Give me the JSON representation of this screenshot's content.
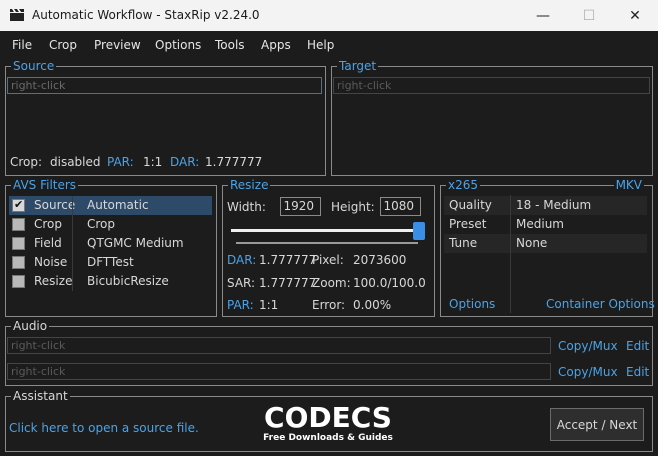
{
  "window": {
    "title": "Automatic Workflow - StaxRip v2.24.0",
    "app_icon": "clapperboard-icon",
    "minimize_glyph": "—",
    "maximize_glyph": "☐",
    "close_glyph": "✕"
  },
  "menu": [
    "File",
    "Crop",
    "Preview",
    "Options",
    "Tools",
    "Apps",
    "Help"
  ],
  "source": {
    "title": "Source",
    "placeholder": "right-click",
    "crop_label": "Crop:",
    "crop_value": "disabled",
    "par_label": "PAR:",
    "par_value": "1:1",
    "dar_label": "DAR:",
    "dar_value": "1.777777"
  },
  "target": {
    "title": "Target",
    "placeholder": "right-click"
  },
  "filters": {
    "title": "AVS Filters",
    "items": [
      {
        "name": "Source",
        "value": "Automatic",
        "checked": true,
        "selected": true
      },
      {
        "name": "Crop",
        "value": "Crop",
        "checked": false,
        "selected": false
      },
      {
        "name": "Field",
        "value": "QTGMC Medium",
        "checked": false,
        "selected": false
      },
      {
        "name": "Noise",
        "value": "DFTTest",
        "checked": false,
        "selected": false
      },
      {
        "name": "Resize",
        "value": "BicubicResize",
        "checked": false,
        "selected": false
      }
    ]
  },
  "resize": {
    "title": "Resize",
    "width_label": "Width:",
    "width_value": "1920",
    "height_label": "Height:",
    "height_value": "1080",
    "dar_label": "DAR:",
    "dar_value": "1.777777",
    "pixel_label": "Pixel:",
    "pixel_value": "2073600",
    "sar_label": "SAR:",
    "sar_value": "1.777777",
    "zoom_label": "Zoom:",
    "zoom_value": "100.0/100.0",
    "par_label": "PAR:",
    "par_value": "1:1",
    "error_label": "Error:",
    "error_value": "0.00%"
  },
  "encoder": {
    "title": "x265",
    "container": "MKV",
    "rows": [
      {
        "key": "Quality",
        "value": "18 - Medium"
      },
      {
        "key": "Preset",
        "value": "Medium"
      },
      {
        "key": "Tune",
        "value": "None"
      }
    ],
    "options_link": "Options",
    "container_options_link": "Container Options"
  },
  "audio": {
    "title": "Audio",
    "tracks": [
      {
        "placeholder": "right-click",
        "copy_mux": "Copy/Mux",
        "edit": "Edit"
      },
      {
        "placeholder": "right-click",
        "copy_mux": "Copy/Mux",
        "edit": "Edit"
      }
    ]
  },
  "assistant": {
    "title": "Assistant",
    "message": "Click here to open a source file.",
    "accept_button": "Accept / Next"
  },
  "watermark": {
    "main": "CODECS",
    "sub": "Free Downloads & Guides"
  },
  "colors": {
    "accent": "#4aa3e8",
    "background": "#1c1c1c",
    "selection": "#2d4a68"
  }
}
